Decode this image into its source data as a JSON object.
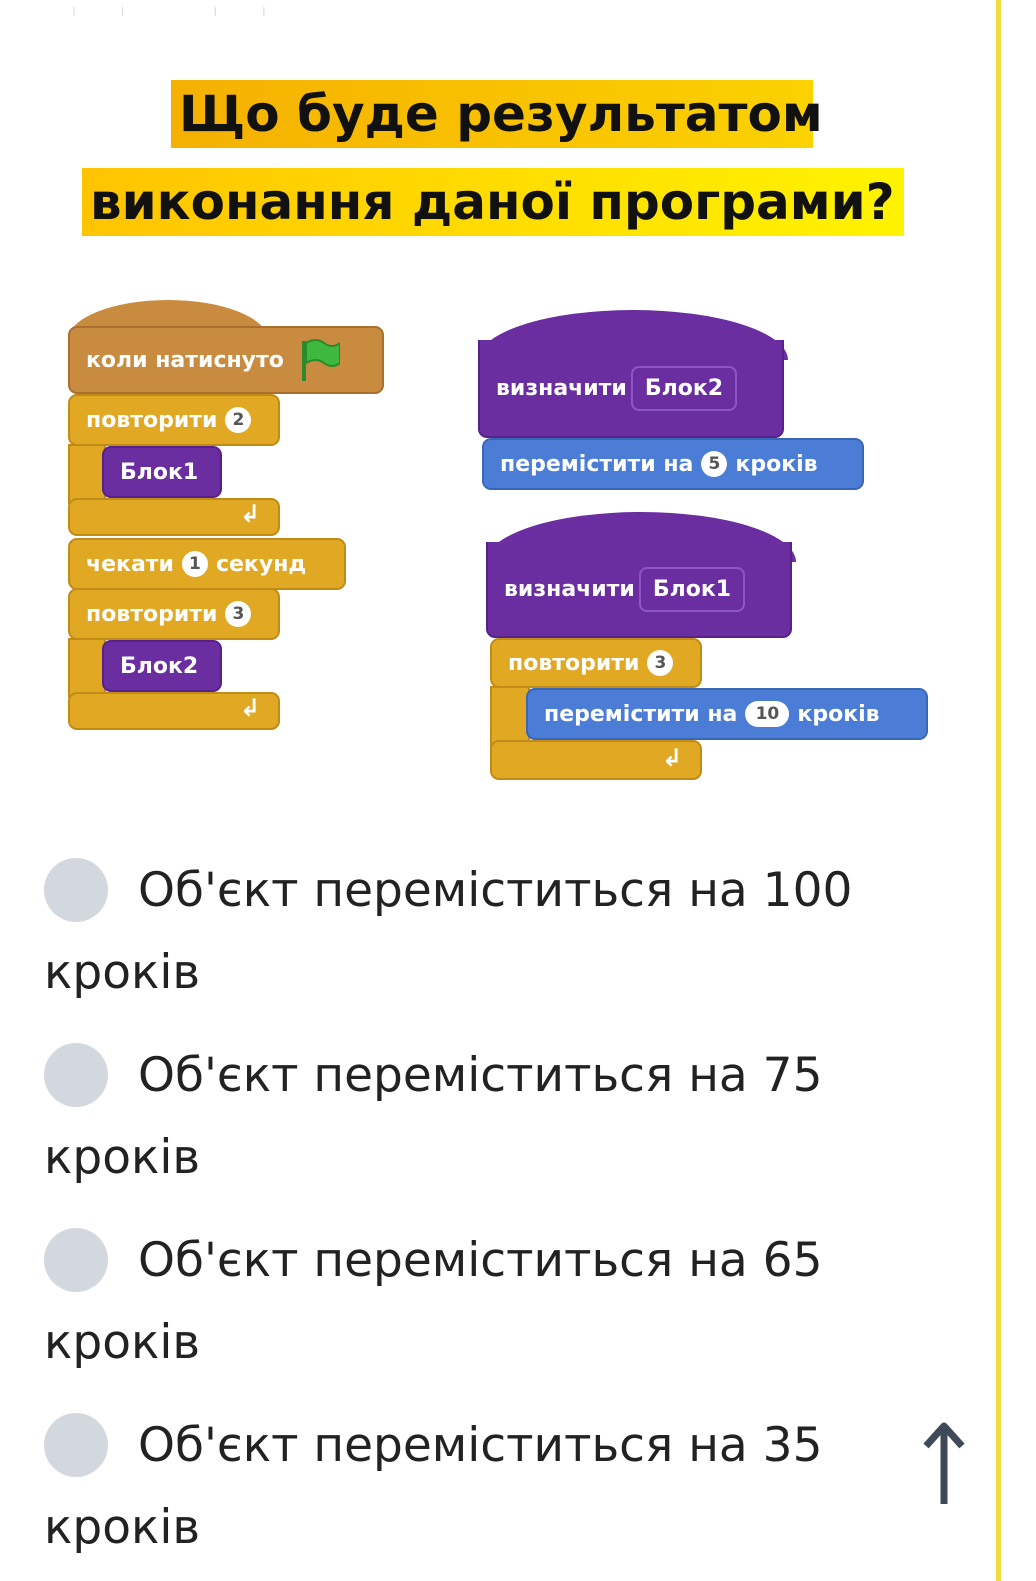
{
  "question": {
    "line1": "Що буде результатом",
    "line2": "виконання даної програми?"
  },
  "program": {
    "main_script": {
      "when_flag": "коли натиснуто",
      "repeat1_label": "повторити",
      "repeat1_count": "2",
      "block1_call": "Блок1",
      "wait_label": "чекати",
      "wait_value": "1",
      "wait_unit": "секунд",
      "repeat2_label": "повторити",
      "repeat2_count": "3",
      "block2_call": "Блок2"
    },
    "define_block2": {
      "define_label": "визначити",
      "block_name": "Блок2",
      "move_label": "перемістити на",
      "move_steps": "5",
      "move_unit": "кроків"
    },
    "define_block1": {
      "define_label": "визначити",
      "block_name": "Блок1",
      "repeat_label": "повторити",
      "repeat_count": "3",
      "move_label": "перемістити на",
      "move_steps": "10",
      "move_unit": "кроків"
    }
  },
  "options": [
    {
      "text": "Об'єкт переміститься на 100 кроків"
    },
    {
      "text": "Об'єкт переміститься на 75 кроків"
    },
    {
      "text": "Об'єкт переміститься на 65 кроків"
    },
    {
      "text": "Об'єкт переміститься на 35 кроків"
    }
  ],
  "colors": {
    "title_highlight": "#ffd400",
    "event_block": "#c98b3f",
    "control_block": "#e0a823",
    "custom_block": "#6a2ea0",
    "motion_block": "#4b7dd6",
    "radio": "#d3d8df",
    "accent_rule": "#f2dc3c"
  },
  "icons": {
    "flag": "green-flag-icon",
    "loop": "loop-arrow-icon",
    "scroll_top": "arrow-up-icon"
  }
}
